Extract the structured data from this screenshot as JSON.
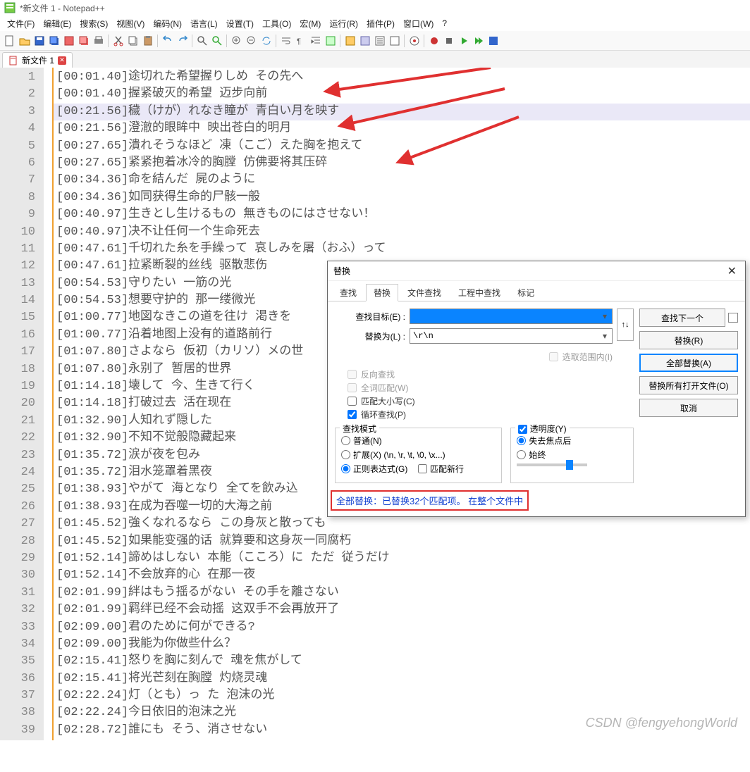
{
  "window_title": "*新文件 1 - Notepad++",
  "menu": [
    "文件(F)",
    "编辑(E)",
    "搜索(S)",
    "视图(V)",
    "编码(N)",
    "语言(L)",
    "设置(T)",
    "工具(O)",
    "宏(M)",
    "运行(R)",
    "插件(P)",
    "窗口(W)",
    "?"
  ],
  "tab_label": "新文件 1",
  "lines": [
    {
      "t": "[00:01.40]途切れた希望握りしめ  その先へ",
      "hl": false
    },
    {
      "t": "[00:01.40]握紧破灭的希望  迈步向前",
      "hl": false
    },
    {
      "t": "[00:21.56]穢（けが）れなき瞳が  青白い月を映す",
      "hl": true
    },
    {
      "t": "[00:21.56]澄澈的眼眸中  映出苍白的明月",
      "hl": false
    },
    {
      "t": "[00:27.65]潰れそうなほど  凍（こご）えた胸を抱えて",
      "hl": false
    },
    {
      "t": "[00:27.65]紧紧抱着冰冷的胸膛  仿佛要将其压碎",
      "hl": false
    },
    {
      "t": "[00:34.36]命を結んだ  屍のように",
      "hl": false
    },
    {
      "t": "[00:34.36]如同获得生命的尸骸一般",
      "hl": false
    },
    {
      "t": "[00:40.97]生きとし生けるもの  無きものにはさせない！",
      "hl": false
    },
    {
      "t": "[00:40.97]决不让任何一个生命死去",
      "hl": false
    },
    {
      "t": "[00:47.61]千切れた糸を手繰って    哀しみを屠（おふ）って",
      "hl": false
    },
    {
      "t": "[00:47.61]拉紧断裂的丝线  驱散悲伤",
      "hl": false
    },
    {
      "t": "[00:54.53]守りたい  一筋の光",
      "hl": false
    },
    {
      "t": "[00:54.53]想要守护的    那一缕微光",
      "hl": false
    },
    {
      "t": "[01:00.77]地図なきこの道を往け  渇きを",
      "hl": false
    },
    {
      "t": "[01:00.77]沿着地图上没有的道路前行",
      "hl": false
    },
    {
      "t": "[01:07.80]さよなら  仮初（カリソ）メの世",
      "hl": false
    },
    {
      "t": "[01:07.80]永别了  暂居的世界",
      "hl": false
    },
    {
      "t": "[01:14.18]壊して  今、生きて行く",
      "hl": false
    },
    {
      "t": "[01:14.18]打破过去  活在现在",
      "hl": false
    },
    {
      "t": "[01:32.90]人知れず隠した",
      "hl": false
    },
    {
      "t": "[01:32.90]不知不觉般隐藏起来",
      "hl": false
    },
    {
      "t": "[01:35.72]涙が夜を包み",
      "hl": false
    },
    {
      "t": "[01:35.72]泪水笼罩着黑夜",
      "hl": false
    },
    {
      "t": "[01:38.93]やがて  海となり  全てを飲み込",
      "hl": false
    },
    {
      "t": "[01:38.93]在成为吞噬一切的大海之前",
      "hl": false
    },
    {
      "t": "[01:45.52]強くなれるなら  この身灰と散っても",
      "hl": false
    },
    {
      "t": "[01:45.52]如果能变强的话  就算要和这身灰一同腐朽",
      "hl": false
    },
    {
      "t": "[01:52.14]諦めはしない  本能（こころ）に  ただ  従うだけ",
      "hl": false
    },
    {
      "t": "[01:52.14]不会放弃的心  在那一夜",
      "hl": false
    },
    {
      "t": "[02:01.99]絆はもう揺るがない  その手を離さない",
      "hl": false
    },
    {
      "t": "[02:01.99]羁绊已经不会动摇  这双手不会再放开了",
      "hl": false
    },
    {
      "t": "[02:09.00]君のために何ができる?",
      "hl": false
    },
    {
      "t": "[02:09.00]我能为你做些什么？",
      "hl": false
    },
    {
      "t": "[02:15.41]怒りを胸に刻んで  魂を焦がして",
      "hl": false
    },
    {
      "t": "[02:15.41]将光芒刻在胸膛  灼烧灵魂",
      "hl": false
    },
    {
      "t": "[02:22.24]灯（とも）っ  た  泡沫の光",
      "hl": false
    },
    {
      "t": "[02:22.24]今日依旧的泡沫之光",
      "hl": false
    },
    {
      "t": "[02:28.72]誰にも  そう、消させない",
      "hl": false
    }
  ],
  "dialog": {
    "title": "替换",
    "tabs": [
      "查找",
      "替换",
      "文件查找",
      "工程中查找",
      "标记"
    ],
    "active_tab": 1,
    "find_label": "查找目标(E) :",
    "replace_label": "替换为(L) :",
    "find_value": "",
    "replace_value": "\\r\\n",
    "swap_label": "↑↓",
    "opt_range": "选取范围内(I)",
    "opt_reverse": "反向查找",
    "opt_whole": "全词匹配(W)",
    "opt_case": "匹配大小写(C)",
    "opt_loop": "循环查找(P)",
    "mode_legend": "查找模式",
    "mode_normal": "普通(N)",
    "mode_extended": "扩展(X) (\\n, \\r, \\t, \\0, \\x...)",
    "mode_regex": "正则表达式(G)",
    "mode_regex_nl": "匹配新行",
    "trans_legend": "透明度(Y)",
    "trans_lostfocus": "失去焦点后",
    "trans_always": "始终",
    "btn_next": "查找下一个",
    "btn_replace": "替换(R)",
    "btn_replaceall": "全部替换(A)",
    "btn_replaceall_open": "替换所有打开文件(O)",
    "btn_cancel": "取消",
    "status": "全部替换：已替换32个匹配项。 在整个文件中"
  },
  "watermark": "CSDN @fengyehongWorld"
}
